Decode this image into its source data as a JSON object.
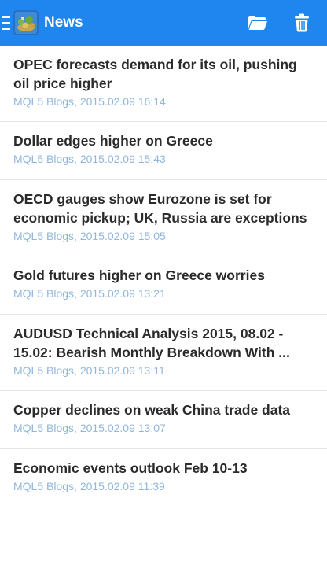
{
  "header": {
    "title": "News",
    "bar_color": "#1f86f0"
  },
  "icons": {
    "menu": "hamburger-menu-icon",
    "logo": "app-logo-icon",
    "folder": "folder-open-icon",
    "trash": "trash-icon"
  },
  "news": [
    {
      "title": "OPEC forecasts demand for its oil, pushing oil price higher",
      "meta": "MQL5 Blogs, 2015.02.09 16:14"
    },
    {
      "title": "Dollar edges higher on Greece",
      "meta": "MQL5 Blogs, 2015.02.09 15:43"
    },
    {
      "title": "OECD gauges show Eurozone is set for economic pickup; UK, Russia are exceptions",
      "meta": "MQL5 Blogs, 2015.02.09 15:05"
    },
    {
      "title": "Gold futures higher on Greece worries",
      "meta": "MQL5 Blogs, 2015.02.09 13:21"
    },
    {
      "title": "AUDUSD Technical Analysis 2015, 08.02 - 15.02: Bearish Monthly Breakdown With ...",
      "meta": "MQL5 Blogs, 2015.02.09 13:11"
    },
    {
      "title": "Copper declines on weak China trade data",
      "meta": "MQL5 Blogs, 2015.02.09 13:07"
    },
    {
      "title": "Economic events outlook Feb 10-13",
      "meta": "MQL5 Blogs, 2015.02.09 11:39"
    }
  ]
}
